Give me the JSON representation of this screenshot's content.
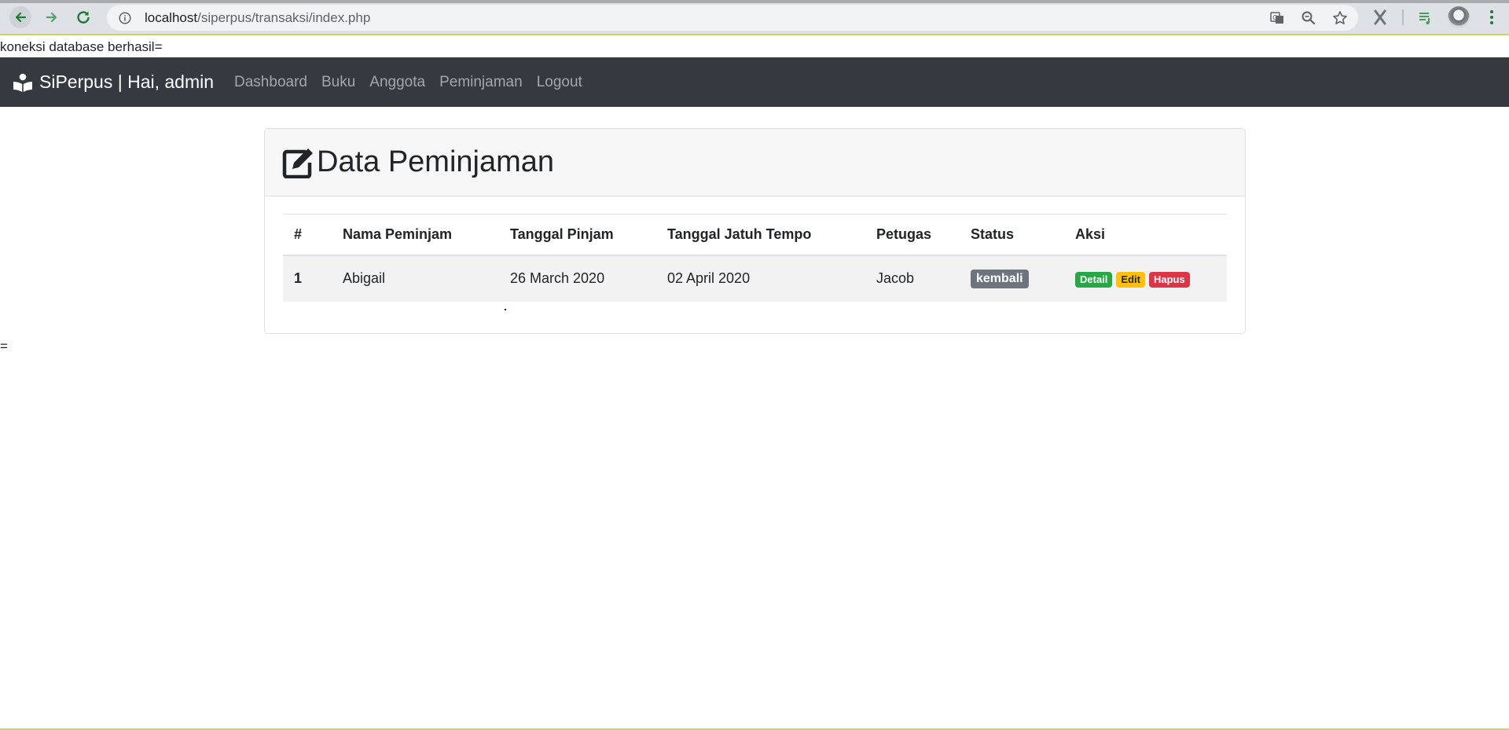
{
  "browser": {
    "url_host": "localhost",
    "url_path": "/siperpus/transaksi/index.php"
  },
  "page": {
    "db_status": "koneksi database berhasil=",
    "trailing_text": "="
  },
  "navbar": {
    "brand": "SiPerpus | Hai, admin",
    "links": [
      "Dashboard",
      "Buku",
      "Anggota",
      "Peminjaman",
      "Logout"
    ]
  },
  "card": {
    "title": "Data Peminjaman"
  },
  "table": {
    "headers": [
      "#",
      "Nama Peminjam",
      "Tanggal Pinjam",
      "Tanggal Jatuh Tempo",
      "Petugas",
      "Status",
      "Aksi"
    ],
    "rows": [
      {
        "num": "1",
        "nama": "Abigail",
        "tanggal_pinjam": "26 March 2020",
        "tanggal_jatuh_tempo": "02 April 2020",
        "petugas": "Jacob",
        "status": "kembali",
        "actions": [
          "Detail",
          "Edit",
          "Hapus"
        ]
      }
    ]
  },
  "colors": {
    "navbar_bg": "#343a40",
    "status_badge": "#6c757d",
    "detail": "#28a745",
    "edit": "#ffc107",
    "hapus": "#dc3545"
  }
}
